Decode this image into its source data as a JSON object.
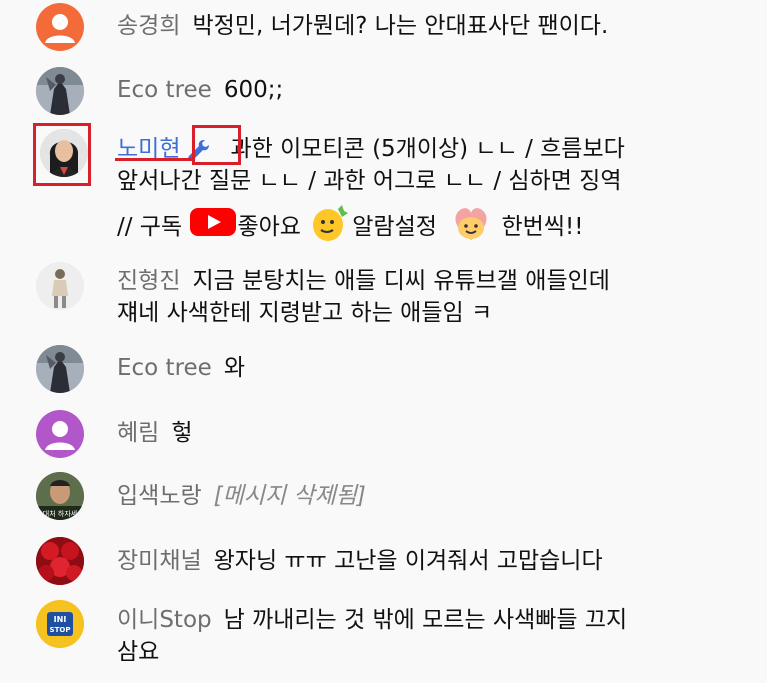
{
  "messages": [
    {
      "author": "송경희",
      "text": "박정민, 너가뭔데? 나는 안대표사단 팬이다.",
      "avatar": "default-orange"
    },
    {
      "author": "Eco tree",
      "text": "600;;",
      "avatar": "photo-figure"
    },
    {
      "author": "노미현",
      "badge_icon": "wrench-icon",
      "line1": "과한 이모티콘 (5개이상) ㄴㄴ / 흐름보다",
      "line2": "앞서나간 질문 ㄴㄴ / 과한 어그로 ㄴㄴ / 심하면 징역",
      "line3_a": "// 구독",
      "line3_b": "좋아요",
      "line3_c": "알람설정",
      "line3_d": "한번씩!!",
      "avatar": "photo-woman"
    },
    {
      "author": "진형진",
      "line1": "지금 분탕치는 애들 디씨 유튜브갤 애들인데",
      "line2": "쟤네 사색한테 지령받고 하는 애들임 ㅋ",
      "avatar": "photo-light"
    },
    {
      "author": "Eco tree",
      "text": "와",
      "avatar": "photo-figure"
    },
    {
      "author": "혜림",
      "text": "헣",
      "avatar": "default-purple"
    },
    {
      "author": "입색노랑",
      "text": "[메시지 삭제됨]",
      "avatar": "photo-man",
      "avatar_caption": "대처 하자세"
    },
    {
      "author": "장미채널",
      "text": "왕자닝 ㅠㅠ 고난을 이겨줘서 고맙습니다",
      "avatar": "photo-roses"
    },
    {
      "author": "이니Stop",
      "line1": "남 까내리는 것 밖에 모르는 사색빠들 끄지",
      "line2": "삼요",
      "avatar": "logo-ini",
      "avatar_caption_top": "INI",
      "avatar_caption_bottom": "STOP"
    }
  ],
  "colors": {
    "background": "#f9f9f9",
    "author": "#6e6e6e",
    "owner_author": "#3e6fd8",
    "highlight_box": "#d9202a",
    "youtube_red": "#ff0000"
  }
}
